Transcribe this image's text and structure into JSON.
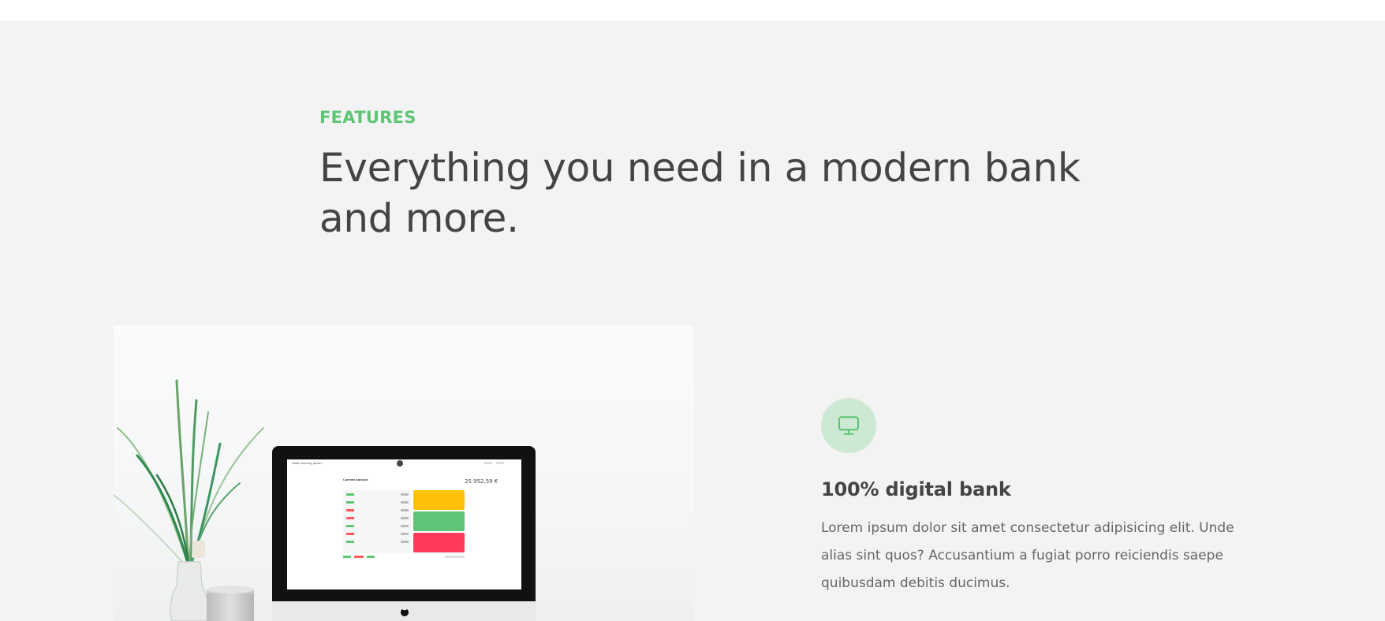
{
  "section": {
    "eyebrow": "Features",
    "heading": "Everything you need in a modern bank and more."
  },
  "feature": {
    "icon": "monitor-icon",
    "title": "100% digital bank",
    "text": "Lorem ipsum dolor sit amet consectetur adipisicing elit. Unde alias sint quos? Accusantium a fugiat porro reiciendis saepe quibusdam debitis ducimus."
  },
  "screen": {
    "greeting": "Good morning, Jonas!",
    "balance_label": "Current balance",
    "balance_value": "25 952,59 €"
  },
  "colors": {
    "accent": "#5ec576",
    "accent_light": "#cde9d3",
    "heading": "#444444",
    "background": "#f3f3f3",
    "card_yellow": "#ffc107",
    "card_green": "#5ec576",
    "card_red": "#ff3b5c"
  }
}
